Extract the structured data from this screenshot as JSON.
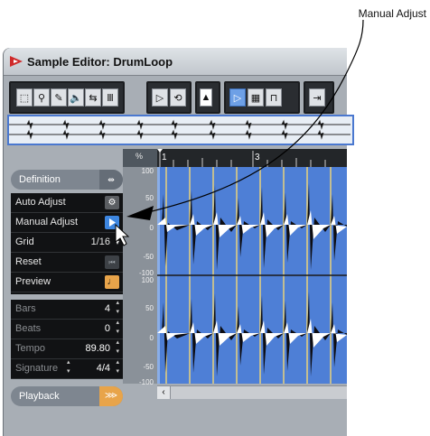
{
  "callout": {
    "text": "Manual Adjust"
  },
  "window": {
    "title": "Sample Editor: DrumLoop"
  },
  "ruler": {
    "scale_label": "%",
    "bar_numbers": [
      "1",
      "3"
    ]
  },
  "scale_ticks": [
    "100",
    "50",
    "0",
    "-50",
    "-100",
    "100",
    "50",
    "0",
    "-50",
    "-100"
  ],
  "inspector": {
    "definition": {
      "label": "Definition"
    },
    "rows": [
      {
        "label": "Auto Adjust",
        "value": ""
      },
      {
        "label": "Manual Adjust",
        "value": ""
      },
      {
        "label": "Grid",
        "value": "1/16"
      },
      {
        "label": "Reset",
        "value": ""
      },
      {
        "label": "Preview",
        "value": ""
      }
    ],
    "values": [
      {
        "label": "Bars",
        "value": "4"
      },
      {
        "label": "Beats",
        "value": "0"
      },
      {
        "label": "Tempo",
        "value": "89.80"
      },
      {
        "label": "Signature",
        "value": "4/4"
      }
    ],
    "playback": {
      "label": "Playback"
    }
  },
  "colors": {
    "accent_blue": "#4e7fd6",
    "warp_orange": "#e8a44a",
    "manual_blue": "#3d86e0",
    "grid_line": "#e8d27a"
  }
}
